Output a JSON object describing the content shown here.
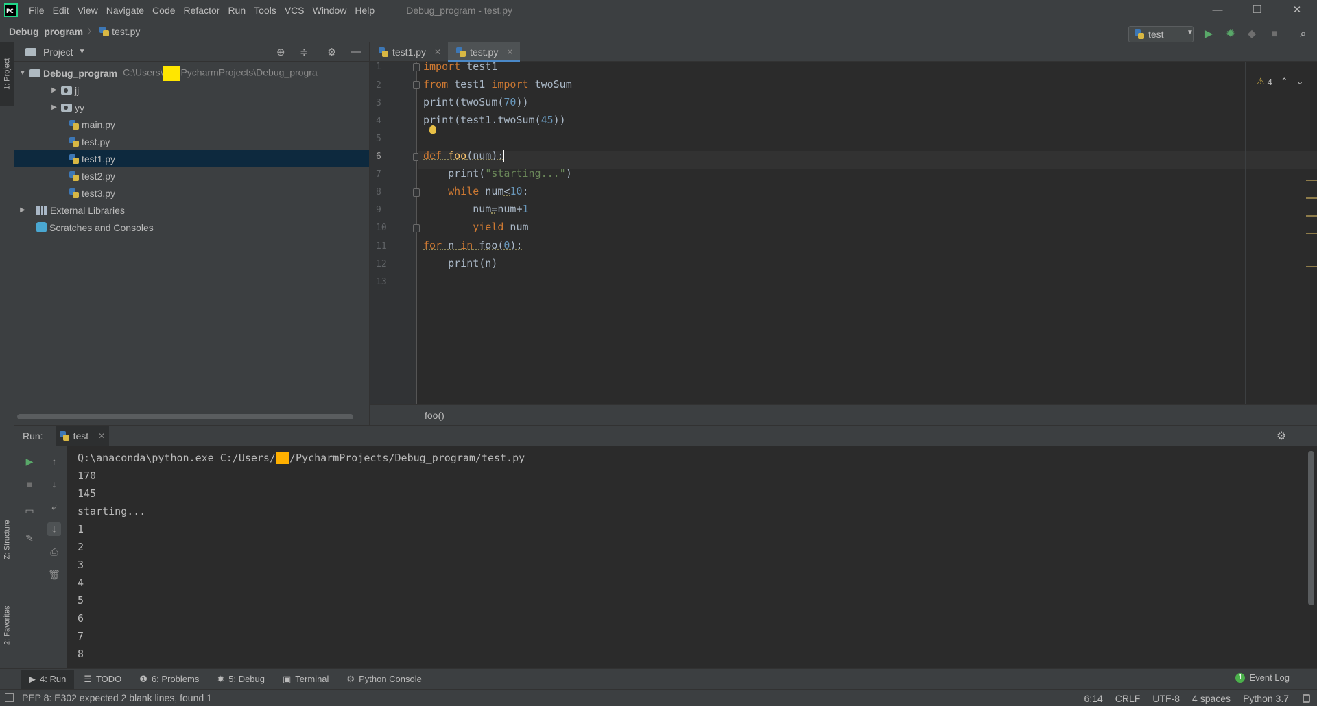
{
  "titlebar": {
    "logo_text": "PC",
    "menu": [
      "File",
      "Edit",
      "View",
      "Navigate",
      "Code",
      "Refactor",
      "Run",
      "Tools",
      "VCS",
      "Window",
      "Help"
    ],
    "window_title": "Debug_program - test.py",
    "controls": {
      "minimize": "—",
      "restore": "❐",
      "close": "✕"
    }
  },
  "navbar": {
    "project": "Debug_program",
    "file": "test.py",
    "run_config": "test"
  },
  "left_strip": {
    "project_tab": "1: Project",
    "structure_tab": "Z: Structure",
    "favorites_tab": "2: Favorites"
  },
  "project": {
    "title": "Project",
    "root_name": "Debug_program",
    "root_path_prefix": "C:\\Users\\",
    "root_path_suffix": "PycharmProjects\\Debug_progra",
    "items": [
      {
        "label": "jj"
      },
      {
        "label": "yy"
      },
      {
        "label": "main.py"
      },
      {
        "label": "test.py"
      },
      {
        "label": "test1.py"
      },
      {
        "label": "test2.py"
      },
      {
        "label": "test3.py"
      }
    ],
    "external": "External Libraries",
    "scratches": "Scratches and Consoles"
  },
  "editor": {
    "tabs": [
      {
        "label": "test1.py"
      },
      {
        "label": "test.py"
      }
    ],
    "line_numbers": [
      "1",
      "2",
      "3",
      "4",
      "5",
      "6",
      "7",
      "8",
      "9",
      "10",
      "11",
      "12",
      "13"
    ],
    "warnings": "4",
    "breadcrumb": "foo()"
  },
  "run": {
    "label": "Run:",
    "tab": "test",
    "cmd_prefix": "Q:\\anaconda\\python.exe C:/Users/",
    "cmd_suffix": "/PycharmProjects/Debug_program/test.py",
    "output": [
      "170",
      "145",
      "starting...",
      "1",
      "2",
      "3",
      "4",
      "5",
      "6",
      "7",
      "8"
    ]
  },
  "tooltabs": {
    "run": "4: Run",
    "todo": "TODO",
    "problems": "6: Problems",
    "debug": "5: Debug",
    "terminal": "Terminal",
    "console": "Python Console",
    "event_log": "Event Log",
    "event_count": "1"
  },
  "status": {
    "message": "PEP 8: E302 expected 2 blank lines, found 1",
    "position": "6:14",
    "line_sep": "CRLF",
    "encoding": "UTF-8",
    "indent": "4 spaces",
    "interpreter": "Python 3.7"
  }
}
